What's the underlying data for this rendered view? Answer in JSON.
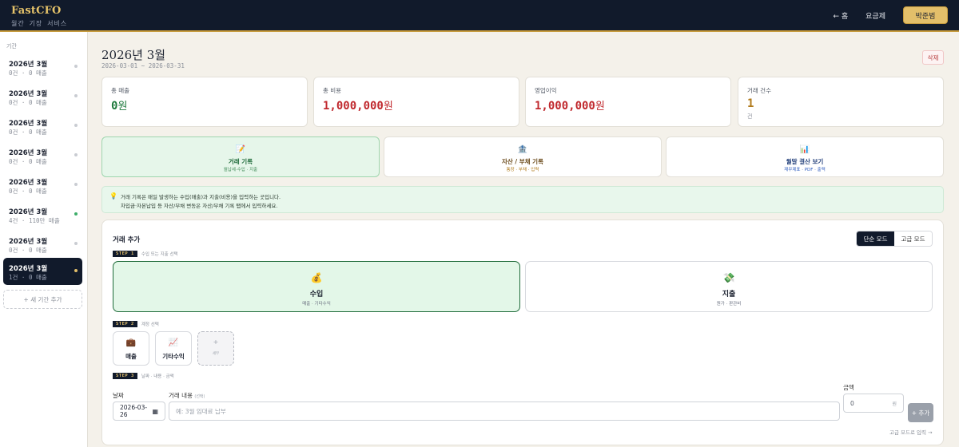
{
  "header": {
    "brand": "FastCFO",
    "brand_sub": "월간 기장 서비스",
    "nav_home": "← 홈",
    "nav_pricing": "요금제",
    "user_name": "박준범"
  },
  "sidebar": {
    "label": "기간",
    "periods": [
      {
        "title": "2026년 3월",
        "meta": "0건 · 0 매출"
      },
      {
        "title": "2026년 3월",
        "meta": "0건 · 0 매출"
      },
      {
        "title": "2026년 3월",
        "meta": "0건 · 0 매출"
      },
      {
        "title": "2026년 3월",
        "meta": "0건 · 0 매출"
      },
      {
        "title": "2026년 3월",
        "meta": "0건 · 0 매출"
      },
      {
        "title": "2026년 3월",
        "meta": "4건 · 110만 매출"
      },
      {
        "title": "2026년 3월",
        "meta": "0건 · 0 매출"
      },
      {
        "title": "2026년 3월",
        "meta": "1건 · 0 매출"
      }
    ],
    "add_label": "+ 새 기간 추가"
  },
  "page": {
    "title": "2026년 3월",
    "range": "2026-03-01 ~ 2026-03-31",
    "delete_label": "삭제"
  },
  "stats": {
    "revenue": {
      "label": "총 매출",
      "value": "0",
      "unit": "원",
      "color": "#1f7a3d"
    },
    "expense": {
      "label": "총 비용",
      "value": "1,000,000",
      "unit": "원",
      "color": "#c0282d"
    },
    "operating": {
      "label": "영업이익",
      "value": "1,000,000",
      "unit": "원",
      "color": "#c0282d"
    },
    "count": {
      "label": "거래 건수",
      "value": "1",
      "sub": "건",
      "color": "#b07a1a"
    }
  },
  "actions": [
    {
      "icon": "memo-icon",
      "glyph": "📝",
      "title": "거래 기록",
      "sub": "월납세·수입 · 지출"
    },
    {
      "icon": "bank-icon",
      "glyph": "🏦",
      "title": "자산 / 부채 기록",
      "sub": "통장 · 부채 · 입력"
    },
    {
      "icon": "chart-icon",
      "glyph": "📊",
      "title": "월말 결산 보기",
      "sub": "재무제표 · PDF · 출력"
    }
  ],
  "notice": {
    "icon": "lightbulb-icon",
    "line1": "거래 기록은 매일 발생하는 수입(매출)과 지출(비용)을 입력하는 곳입니다.",
    "line2": "차입금·자본납입 등 자산/부채 변동은 자산/부채 기록 탭에서 입력하세요."
  },
  "panel": {
    "title": "거래 추가",
    "mode_simple": "단순 모드",
    "mode_advanced": "고급 모드",
    "step1_badge": "STEP 1",
    "step1_text": "수입 또는 지출 선택",
    "income": {
      "icon": "money-bag-icon",
      "glyph": "💰",
      "title": "수입",
      "sub": "매출 · 기타수익"
    },
    "expense": {
      "icon": "money-wings-icon",
      "glyph": "💸",
      "title": "지출",
      "sub": "원가 · 판관비"
    },
    "step2_badge": "STEP 2",
    "step2_text": "계정 선택",
    "accounts": [
      {
        "icon": "briefcase-icon",
        "glyph": "💼",
        "label": "매출"
      },
      {
        "icon": "trend-up-icon",
        "glyph": "📈",
        "label": "기타수익"
      }
    ],
    "more_account": {
      "glyph": "+",
      "label": "세부"
    },
    "step3_badge": "STEP 3",
    "step3_text": "날짜 · 내용 · 금액",
    "date_label": "날짜",
    "date_value": "2026-03-26",
    "desc_label": "거래 내용",
    "desc_hint": "(선택)",
    "desc_placeholder": "예: 3월 임대료 납부",
    "amount_label": "금액",
    "amount_placeholder": "0",
    "amount_unit": "원",
    "add_label": "+ 추가",
    "adv_link": "고급 모드로 입력 →"
  },
  "colors": {
    "navy": "#111a2b",
    "gold": "#e3bf6a",
    "green_bg": "#e3f7e8"
  }
}
